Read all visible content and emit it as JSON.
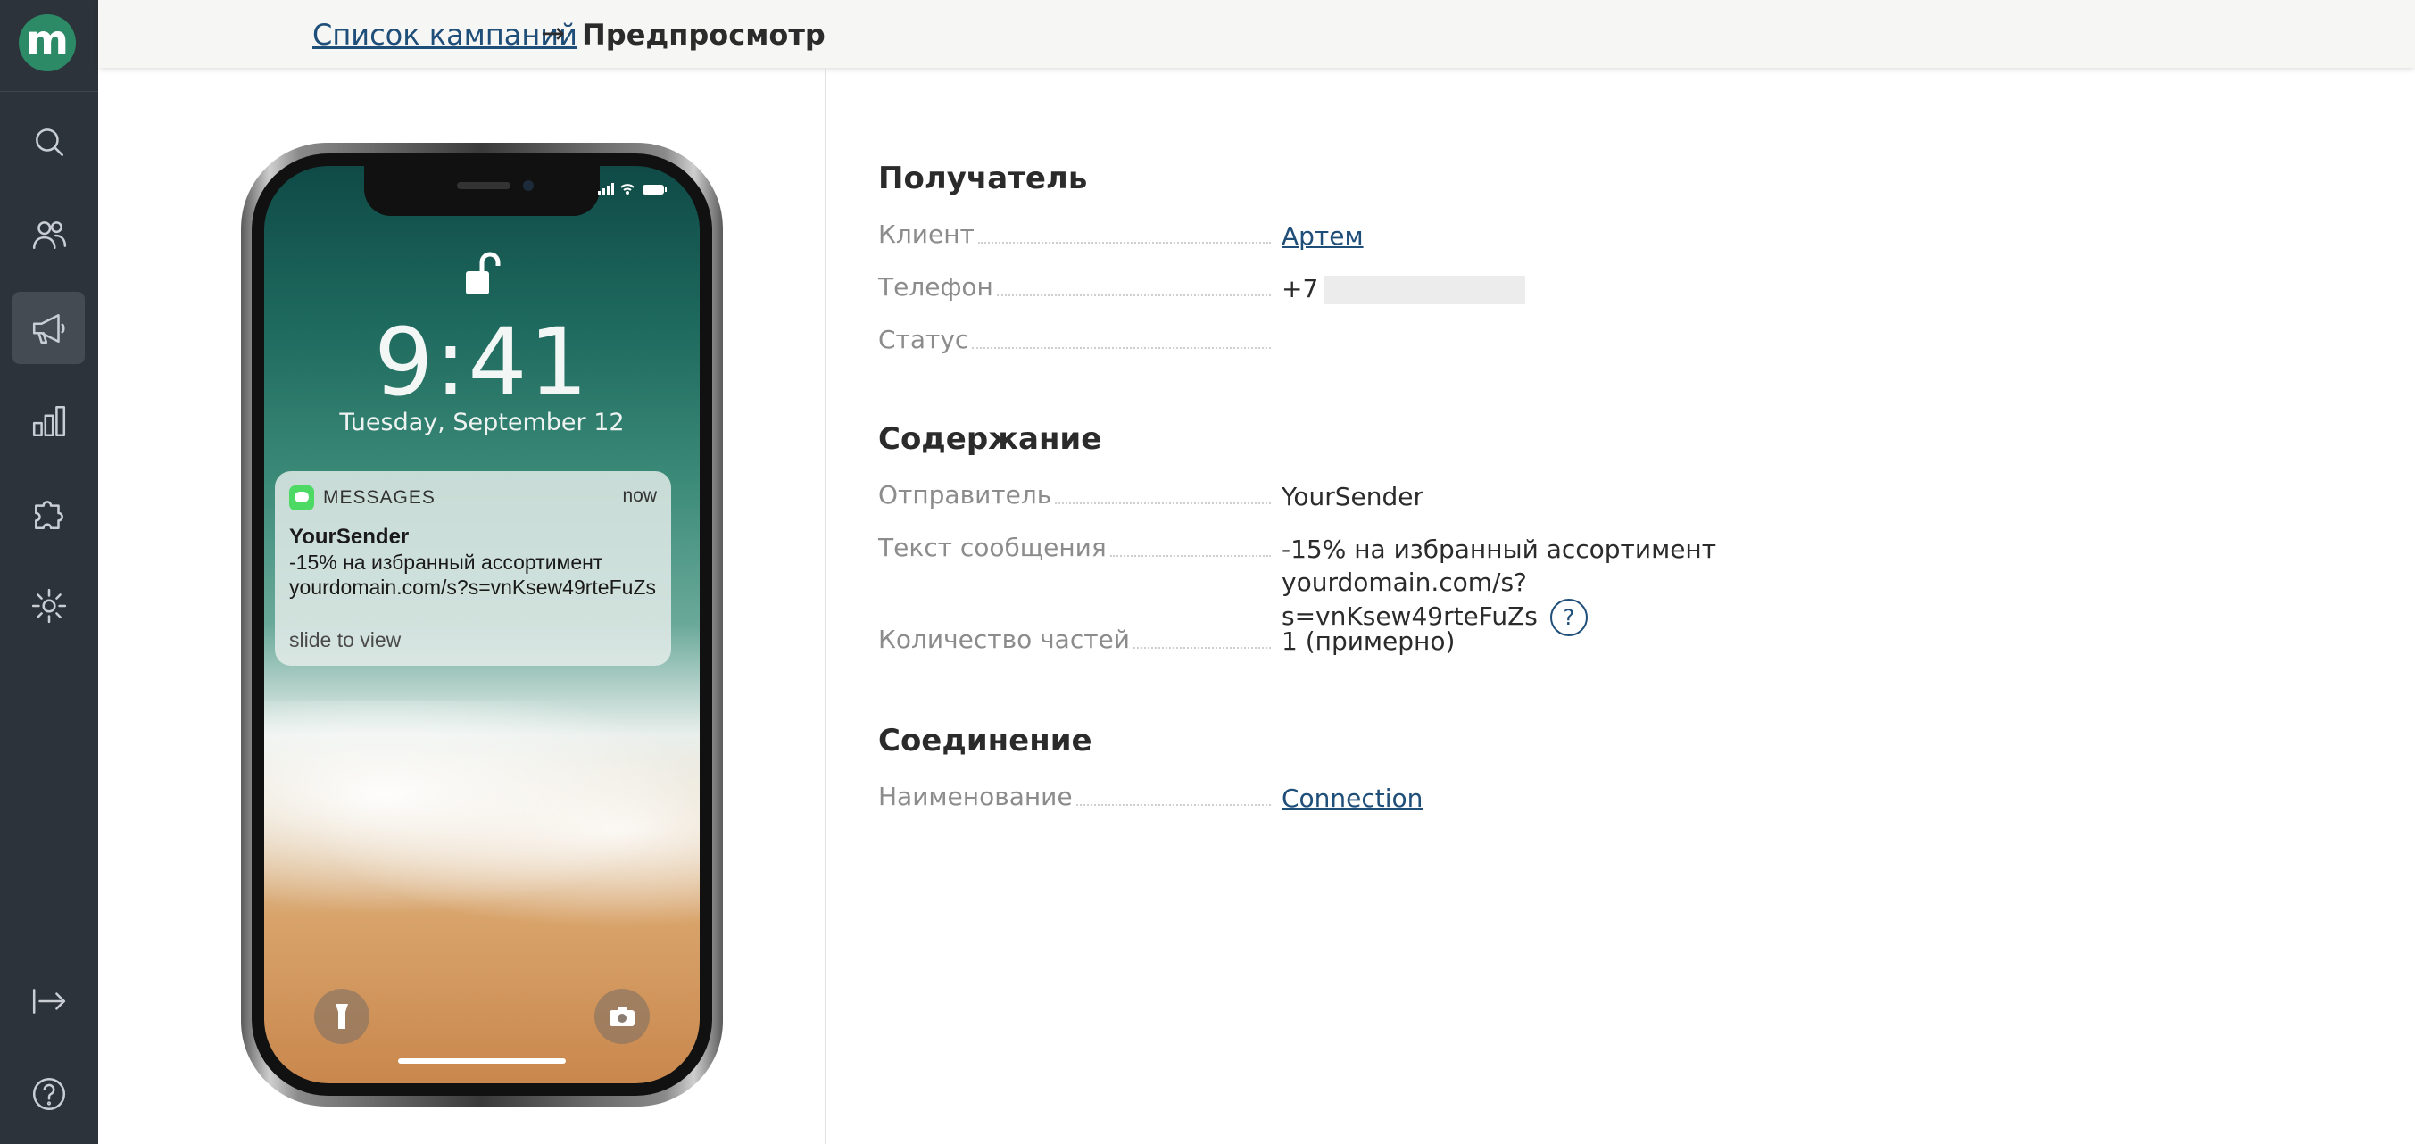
{
  "app": {
    "logo_letter": "m",
    "accent_color": "#2c8a67",
    "sidebar_bg": "#2d333a"
  },
  "sidebar": {
    "items": [
      {
        "icon": "search-icon",
        "active": false
      },
      {
        "icon": "users-icon",
        "active": false
      },
      {
        "icon": "megaphone-icon",
        "active": true
      },
      {
        "icon": "bar-chart-icon",
        "active": false
      },
      {
        "icon": "puzzle-icon",
        "active": false
      },
      {
        "icon": "gear-icon",
        "active": false
      },
      {
        "icon": "logout-icon",
        "active": false
      },
      {
        "icon": "help-icon",
        "active": false
      }
    ]
  },
  "breadcrumb": {
    "parent": "Список кампаний",
    "arrow": "→",
    "current": "Предпросмотр"
  },
  "phone_preview": {
    "time": "9:41",
    "date": "Tuesday, September 12",
    "notification": {
      "app": "MESSAGES",
      "time": "now",
      "sender": "YourSender",
      "body": "-15% на избранный ассортимент yourdomain.com/s?s=vnKsew49rteFuZs",
      "hint": "slide to view"
    }
  },
  "recipient": {
    "title": "Получатель",
    "client_label": "Клиент",
    "client_value": "Артем",
    "phone_label": "Телефон",
    "phone_value": "+7",
    "status_label": "Статус",
    "status_value": ""
  },
  "content": {
    "title": "Содержание",
    "sender_label": "Отправитель",
    "sender_value": "YourSender",
    "text_label": "Текст сообщения",
    "text_line1": "-15% на избранный ассортимент yourdomain.com/s?",
    "text_line2": "s=vnKsew49rteFuZs",
    "help_symbol": "?",
    "parts_label": "Количество частей",
    "parts_value": "1 (примерно)"
  },
  "connection": {
    "title": "Соединение",
    "name_label": "Наименование",
    "name_value": "Connection"
  }
}
